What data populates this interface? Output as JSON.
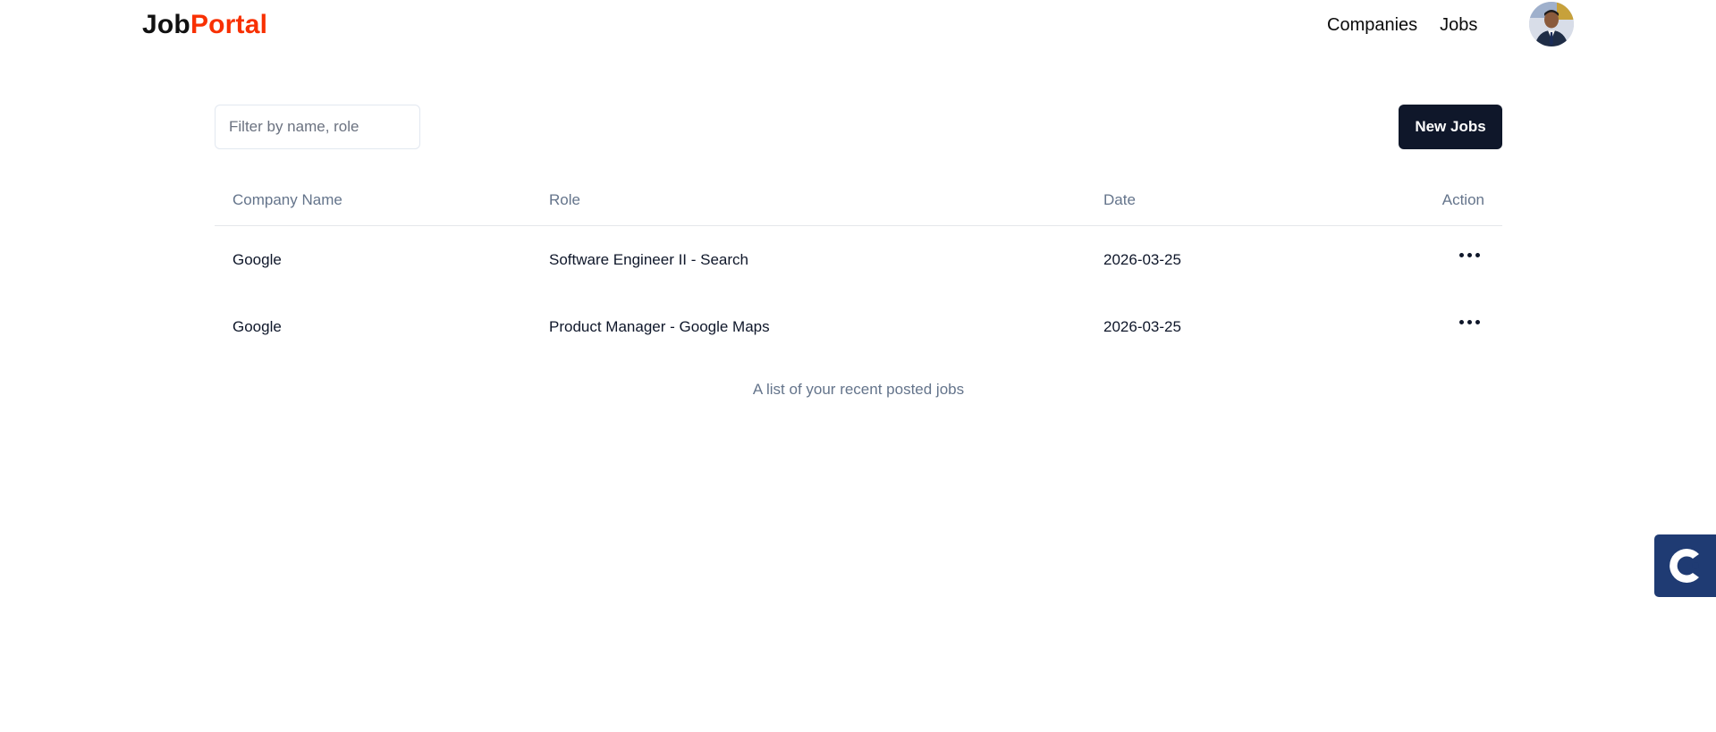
{
  "app": {
    "logo_primary": "Job",
    "logo_accent": "Portal",
    "accent_color": "#f83002"
  },
  "nav": {
    "links": [
      "Companies",
      "Jobs"
    ]
  },
  "toolbar": {
    "filter_placeholder": "Filter by name, role",
    "new_jobs_label": "New Jobs"
  },
  "table": {
    "headers": [
      "Company Name",
      "Role",
      "Date",
      "Action"
    ],
    "rows": [
      {
        "company": "Google",
        "role": "Software Engineer II - Search",
        "date": "2026-03-25"
      },
      {
        "company": "Google",
        "role": "Product Manager - Google Maps",
        "date": "2026-03-25"
      }
    ],
    "caption": "A list of your recent posted jobs"
  },
  "icons": {
    "avatar": "avatar",
    "row_action": "more-horizontal-icon",
    "floating_widget": "c-logo-icon"
  }
}
